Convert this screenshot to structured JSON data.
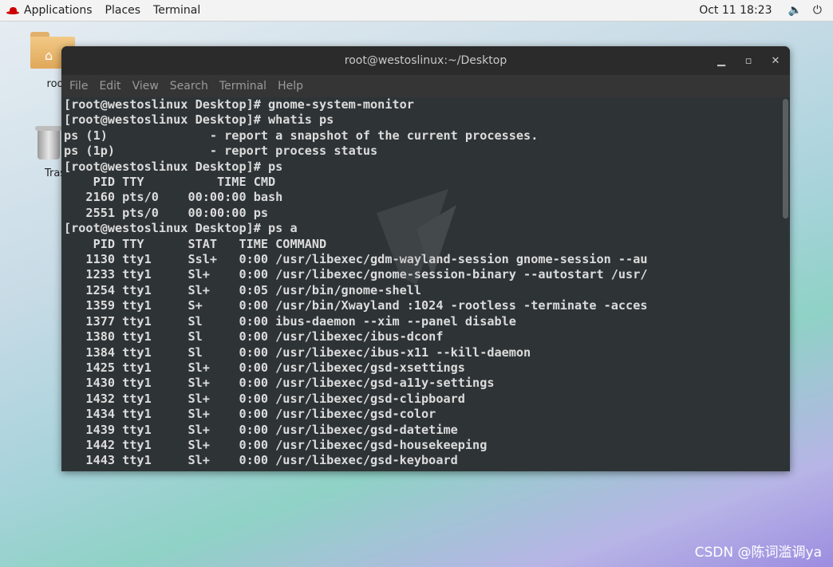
{
  "topbar": {
    "applications": "Applications",
    "places": "Places",
    "terminal": "Terminal",
    "clock": "Oct 11  18:23",
    "volume_icon": "volume-icon",
    "power_icon": "power-icon"
  },
  "desktop": {
    "home_label": "roo",
    "trash_label": "Tras"
  },
  "window": {
    "title": "root@westoslinux:~/Desktop",
    "menu": [
      "File",
      "Edit",
      "View",
      "Search",
      "Terminal",
      "Help"
    ],
    "lines": [
      "[root@westoslinux Desktop]# gnome-system-monitor",
      "[root@westoslinux Desktop]# whatis ps",
      "ps (1)              - report a snapshot of the current processes.",
      "ps (1p)             - report process status",
      "[root@westoslinux Desktop]# ps",
      "    PID TTY          TIME CMD",
      "   2160 pts/0    00:00:00 bash",
      "   2551 pts/0    00:00:00 ps",
      "[root@westoslinux Desktop]# ps a",
      "    PID TTY      STAT   TIME COMMAND",
      "   1130 tty1     Ssl+   0:00 /usr/libexec/gdm-wayland-session gnome-session --au",
      "   1233 tty1     Sl+    0:00 /usr/libexec/gnome-session-binary --autostart /usr/",
      "   1254 tty1     Sl+    0:05 /usr/bin/gnome-shell",
      "   1359 tty1     S+     0:00 /usr/bin/Xwayland :1024 -rootless -terminate -acces",
      "   1377 tty1     Sl     0:00 ibus-daemon --xim --panel disable",
      "   1380 tty1     Sl     0:00 /usr/libexec/ibus-dconf",
      "   1384 tty1     Sl     0:00 /usr/libexec/ibus-x11 --kill-daemon",
      "   1425 tty1     Sl+    0:00 /usr/libexec/gsd-xsettings",
      "   1430 tty1     Sl+    0:00 /usr/libexec/gsd-a11y-settings",
      "   1432 tty1     Sl+    0:00 /usr/libexec/gsd-clipboard",
      "   1434 tty1     Sl+    0:00 /usr/libexec/gsd-color",
      "   1439 tty1     Sl+    0:00 /usr/libexec/gsd-datetime",
      "   1442 tty1     Sl+    0:00 /usr/libexec/gsd-housekeeping",
      "   1443 tty1     Sl+    0:00 /usr/libexec/gsd-keyboard"
    ]
  },
  "watermark": "CSDN @陈词滥调ya"
}
